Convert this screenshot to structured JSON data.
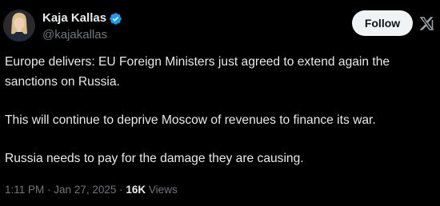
{
  "author": {
    "display_name": "Kaja Kallas",
    "handle": "@kajakallas",
    "verified": true
  },
  "actions": {
    "follow_label": "Follow"
  },
  "icons": {
    "verified": "verified-badge-icon",
    "grok": "x-logo-icon"
  },
  "tweet": {
    "paragraphs": [
      "Europe delivers: EU Foreign Ministers just agreed to extend again the sanctions on Russia.",
      "This will continue to deprive Moscow of revenues to finance its war.",
      "Russia needs to pay for the damage they are causing."
    ],
    "time": "1:11 PM",
    "separator": "·",
    "date": "Jan 27, 2025",
    "views_count": "16K",
    "views_label": "Views"
  },
  "colors": {
    "background": "#000000",
    "text": "#e7e9ea",
    "secondary": "#71767b",
    "verified": "#1d9bf0",
    "button_bg": "#eff3f4"
  }
}
